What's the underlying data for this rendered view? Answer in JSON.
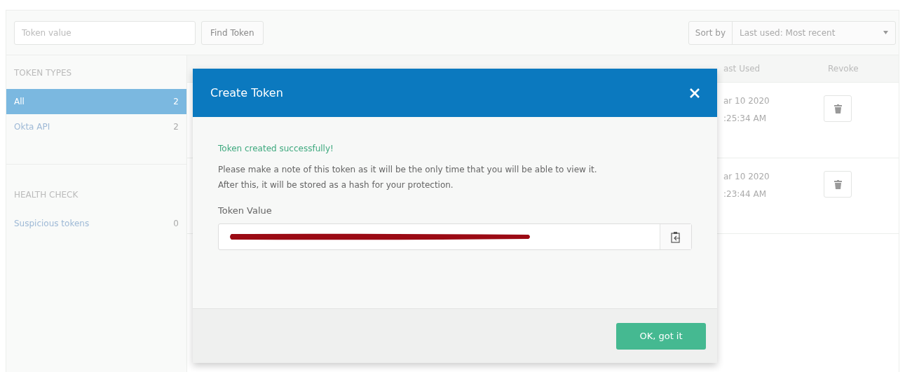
{
  "toolbar": {
    "search": {
      "placeholder": "Token value"
    },
    "find_button": "Find Token",
    "sort": {
      "label": "Sort by",
      "value": "Last used: Most recent"
    }
  },
  "sidebar": {
    "sections": [
      {
        "title": "TOKEN TYPES",
        "items": [
          {
            "label": "All",
            "count": "2",
            "selected": true
          },
          {
            "label": "Okta API",
            "count": "2",
            "selected": false
          }
        ]
      },
      {
        "title": "HEALTH CHECK",
        "items": [
          {
            "label": "Suspicious tokens",
            "count": "0",
            "selected": false
          }
        ]
      }
    ]
  },
  "table": {
    "columns": [
      "ast Used",
      "Revoke"
    ],
    "rows": [
      {
        "last_used": [
          "ar 10 2020",
          ":25:34 AM"
        ]
      },
      {
        "last_used": [
          "ar 10 2020",
          ":23:44 AM"
        ]
      }
    ]
  },
  "dialog": {
    "title": "Create Token",
    "success": "Token created successfully!",
    "message": [
      "Please make a note of this token as it will be the only time that you will be able to view it.",
      "After this, it will be stored as a hash for your protection."
    ],
    "field_label": "Token Value",
    "ok_button": "OK, got it"
  }
}
